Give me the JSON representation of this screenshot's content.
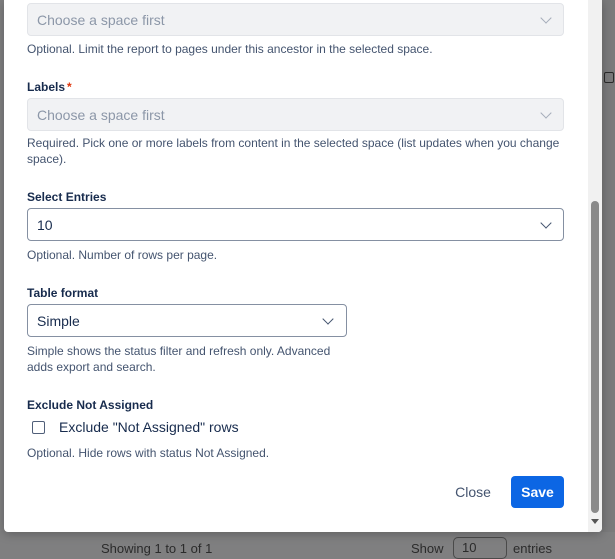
{
  "background": {
    "footer_showing": "Showing 1 to 1 of 1",
    "footer_show_label": "Show",
    "footer_show_value": "10",
    "footer_entries_label": "entries"
  },
  "modal": {
    "ancestor": {
      "placeholder": "Choose a space first",
      "help": "Optional. Limit the report to pages under this ancestor in the selected space."
    },
    "labels": {
      "label": "Labels",
      "required_mark": "*",
      "placeholder": "Choose a space first",
      "help": "Required. Pick one or more labels from content in the selected space (list updates when you change space)."
    },
    "select_entries": {
      "label": "Select Entries",
      "value": "10",
      "help": "Optional. Number of rows per page."
    },
    "table_format": {
      "label": "Table format",
      "value": "Simple",
      "help": "Simple shows the status filter and refresh only. Advanced adds export and search."
    },
    "exclude_not_assigned": {
      "label": "Exclude Not Assigned",
      "checkbox_label": "Exclude \"Not Assigned\" rows",
      "checked": false,
      "help": "Optional. Hide rows with status Not Assigned."
    },
    "buttons": {
      "close": "Close",
      "save": "Save"
    }
  },
  "colors": {
    "primary": "#0c66e4",
    "required": "#de350b",
    "overlay": "#7f7f80"
  }
}
